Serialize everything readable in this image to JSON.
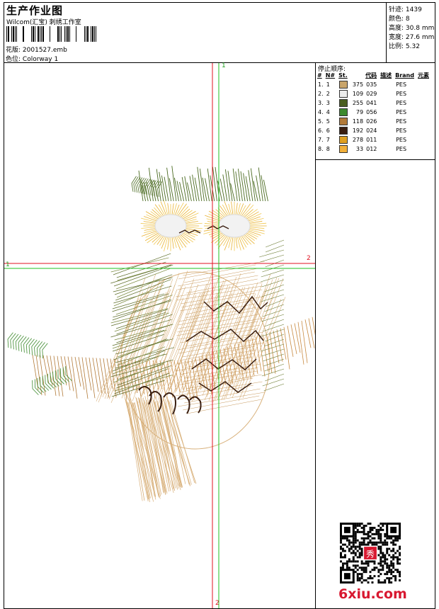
{
  "header": {
    "title": "生产作业图",
    "company": "Wilcom(汇宝) 刺绣工作室",
    "pattern_label": "花版:",
    "pattern_value": "2001527.emb",
    "colorway_label": "色位:",
    "colorway_value": "Colorway 1"
  },
  "specs": {
    "stitches_label": "针迹:",
    "stitches_value": "1439",
    "colors_label": "颜色:",
    "colors_value": "8",
    "height_label": "高度:",
    "height_value": "30.8 mm",
    "width_label": "宽度:",
    "width_value": "27.6 mm",
    "ratio_label": "比例:",
    "ratio_value": "5.32"
  },
  "sequence": {
    "title": "停止顺序:",
    "headers": [
      "#",
      "N#",
      "St.",
      "代码",
      "描述",
      "Brand",
      "元素"
    ],
    "rows": [
      {
        "n": "1.",
        "idx": "1",
        "color": "#c9a56b",
        "st": "375",
        "code": "035",
        "brand": "PES"
      },
      {
        "n": "2.",
        "idx": "2",
        "color": "#ececec",
        "st": "109",
        "code": "029",
        "brand": "PES"
      },
      {
        "n": "3.",
        "idx": "3",
        "color": "#4a5e20",
        "st": "255",
        "code": "041",
        "brand": "PES"
      },
      {
        "n": "4.",
        "idx": "4",
        "color": "#3d8a2e",
        "st": "79",
        "code": "056",
        "brand": "PES"
      },
      {
        "n": "5.",
        "idx": "5",
        "color": "#b27a38",
        "st": "118",
        "code": "026",
        "brand": "PES"
      },
      {
        "n": "6.",
        "idx": "6",
        "color": "#3a1e10",
        "st": "192",
        "code": "024",
        "brand": "PES"
      },
      {
        "n": "7.",
        "idx": "7",
        "color": "#e0a020",
        "st": "278",
        "code": "011",
        "brand": "PES"
      },
      {
        "n": "8.",
        "idx": "8",
        "color": "#f2b03a",
        "st": "33",
        "code": "012",
        "brand": "PES"
      }
    ]
  },
  "crosshair": {
    "label_1_top": "1",
    "label_1_left": "1",
    "label_2_right": "2",
    "label_2_bottom": "2"
  },
  "watermark": {
    "text": "6xiu.com",
    "stamp_text": "秀"
  }
}
